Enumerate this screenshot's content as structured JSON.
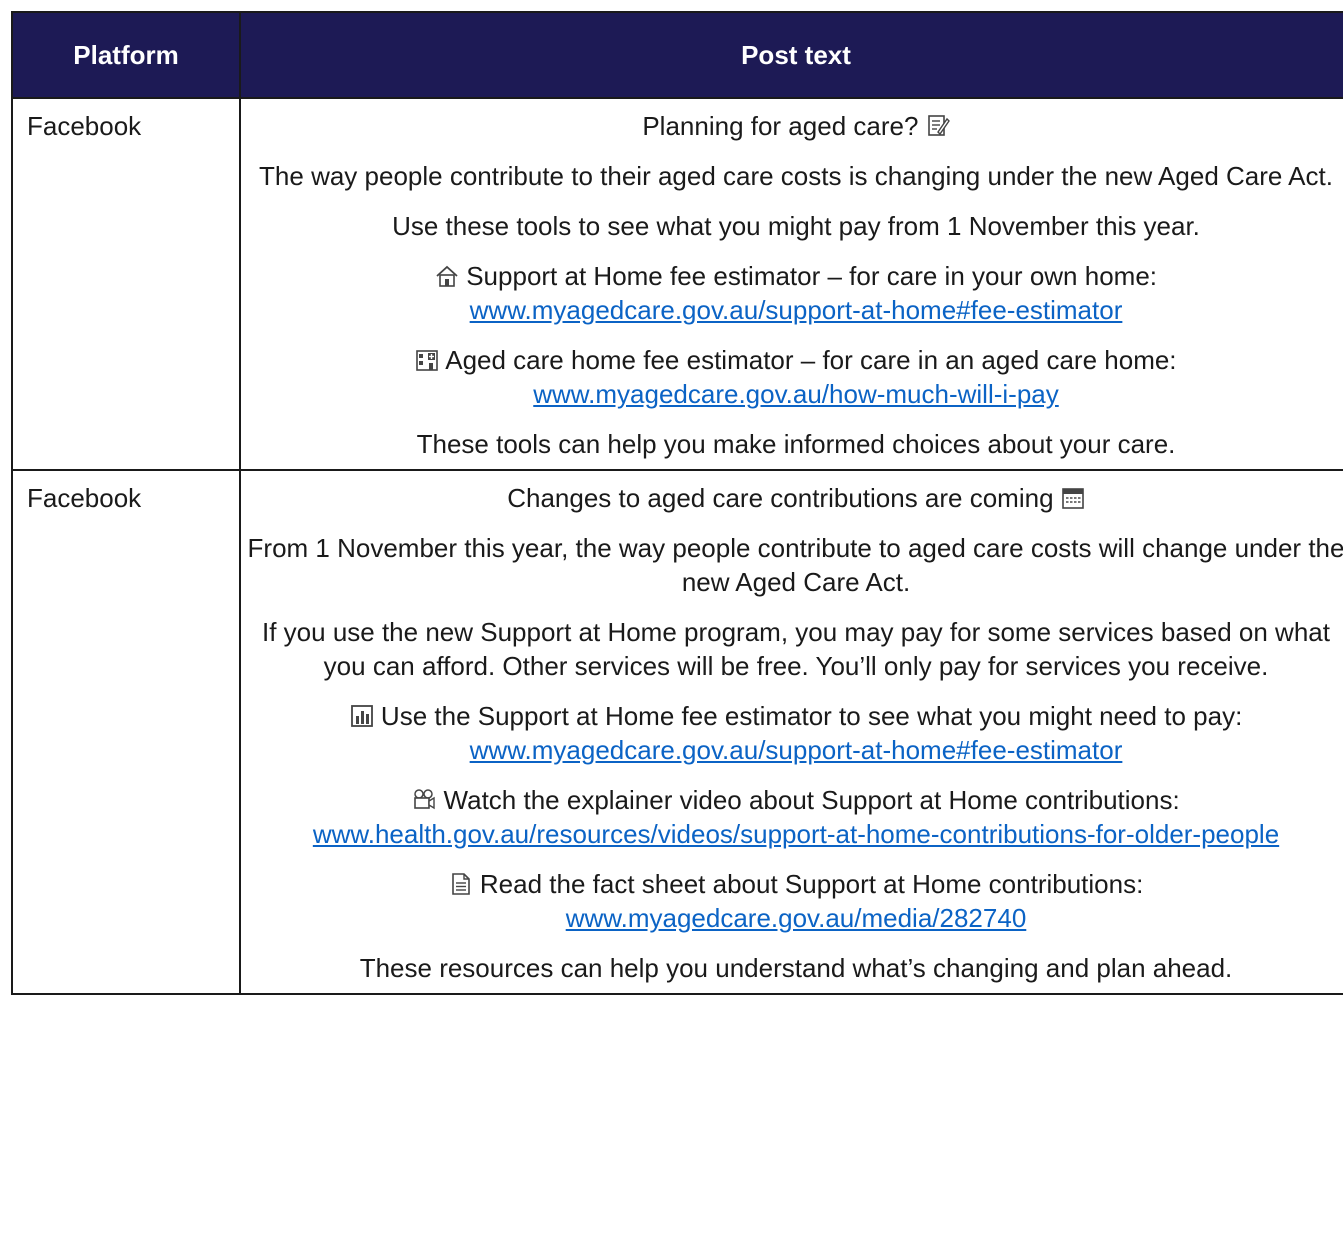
{
  "table": {
    "headers": {
      "platform": "Platform",
      "post_text": "Post text"
    },
    "rows": [
      {
        "platform": "Facebook",
        "title": "Planning for aged care?",
        "title_icon": "memo-icon",
        "p1": "The way people contribute to their aged care costs is changing under the new Aged Care Act.",
        "p2": "Use these tools to see what you might pay from 1 November this year.",
        "item1_icon": "house-icon",
        "item1_text": "Support at Home fee estimator – for care in your own home:",
        "item1_link": "www.myagedcare.gov.au/support-at-home#fee-estimator",
        "item2_icon": "hospital-icon",
        "item2_text": "Aged care home fee estimator – for care in an aged care home:",
        "item2_link": "www.myagedcare.gov.au/how-much-will-i-pay",
        "closing": "These tools can help you make informed choices about your care."
      },
      {
        "platform": "Facebook",
        "title": "Changes to aged care contributions are coming",
        "title_icon": "calendar-icon",
        "p1": "From 1 November this year, the way people contribute to aged care costs will change under the new Aged Care Act.",
        "p2": "If you use the new Support at Home program, you may pay for some services based on what you can afford. Other services will be free. You’ll only pay for services you receive.",
        "item1_icon": "bar-chart-icon",
        "item1_text": "Use the Support at Home fee estimator to see what you might need to pay:",
        "item1_link": "www.myagedcare.gov.au/support-at-home#fee-estimator",
        "item2_icon": "video-camera-icon",
        "item2_text": "Watch the explainer video about Support at Home contributions:",
        "item2_link": "www.health.gov.au/resources/videos/support-at-home-contributions-for-older-people",
        "item3_icon": "document-icon",
        "item3_text": "Read the fact sheet about Support at Home contributions:",
        "item3_link": "www.myagedcare.gov.au/media/282740",
        "closing": "These resources can help you understand what’s changing and plan ahead."
      }
    ]
  }
}
